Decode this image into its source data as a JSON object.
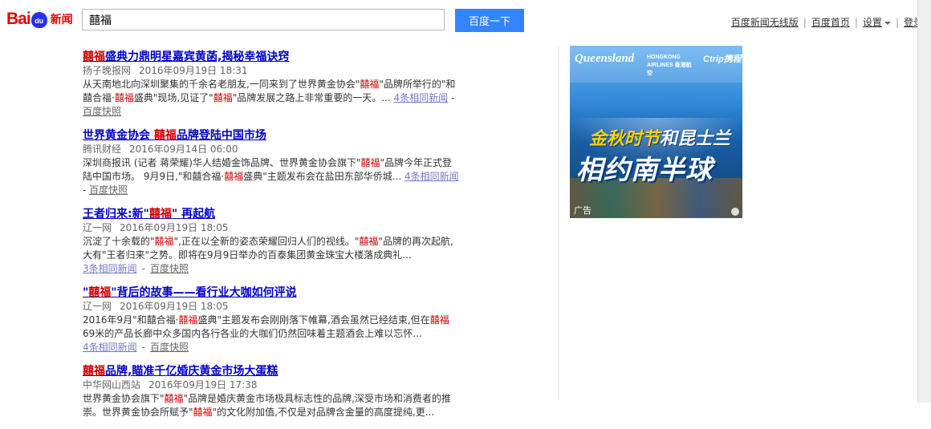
{
  "header": {
    "logo_bai": "Bai",
    "logo_du": "du",
    "logo_news": "新闻",
    "search_value": "囍福",
    "search_button": "百度一下",
    "links": {
      "mobile": "百度新闻无线版",
      "home": "百度首页",
      "settings": "设置",
      "login": "登录"
    }
  },
  "results": [
    {
      "title_hl": "囍福",
      "title_rest": "盛典力鼎明星嘉宾黄菡,揭秘幸福诀窍",
      "source": "扬子晚报网",
      "time": "2016年09月19日 18:31",
      "desc_parts": [
        {
          "t": "从天南地北向深圳聚集的千余名老朋友,一同来到了世界黄金协会\""
        },
        {
          "t": "囍福",
          "hl": true
        },
        {
          "t": "\"品牌所举行的\"和囍合福·"
        },
        {
          "t": "囍福",
          "hl": true
        },
        {
          "t": "盛典\"现场,见证了\""
        },
        {
          "t": "囍福",
          "hl": true
        },
        {
          "t": "\"品牌发展之路上非常重要的一天。..."
        }
      ],
      "same_news": "4条相同新闻",
      "snapshot": "百度快照"
    },
    {
      "title_pre": "世界黄金协会 ",
      "title_hl": "囍福",
      "title_rest": "品牌登陆中国市场",
      "source": "腾讯财经",
      "time": "2016年09月14日 06:00",
      "desc_parts": [
        {
          "t": "深圳商报讯 (记者 蒋荣耀)华人结婚金饰品牌、世界黄金协会旗下\""
        },
        {
          "t": "囍福",
          "hl": true
        },
        {
          "t": "\"品牌今年正式登陆中国市场。 9月9日,\"和囍合福·"
        },
        {
          "t": "囍福",
          "hl": true
        },
        {
          "t": "盛典\"主题发布会在盐田东部华侨城..."
        }
      ],
      "same_news": "4条相同新闻",
      "snapshot": "百度快照"
    },
    {
      "title_pre": "王者归来:新\"",
      "title_hl": "囍福",
      "title_rest": "\" 再起航",
      "source": "辽一网",
      "time": "2016年09月19日 18:05",
      "desc_parts": [
        {
          "t": "沉淀了十余载的\""
        },
        {
          "t": "囍福",
          "hl": true
        },
        {
          "t": "\",正在以全新的姿态荣耀回归人们的视线。\""
        },
        {
          "t": "囍福",
          "hl": true
        },
        {
          "t": "\"品牌的再次起航,大有\"王者归来\"之势。即将在9月9日举办的百泰集团黄金珠宝大楼落成典礼..."
        }
      ],
      "same_news": "3条相同新闻",
      "snapshot": "百度快照"
    },
    {
      "title_pre": "\"",
      "title_hl": "囍福",
      "title_rest": "\"背后的故事——看行业大咖如何评说",
      "source": "辽一网",
      "time": "2016年09月19日 18:05",
      "desc_parts": [
        {
          "t": "2016年9月\"和囍合福·"
        },
        {
          "t": "囍福",
          "hl": true
        },
        {
          "t": "盛典\"主题发布会刚刚落下帷幕,酒会虽然已经结束,但在"
        },
        {
          "t": "囍福",
          "hl": true
        },
        {
          "t": "69米的产品长廊中众多国内各行各业的大咖们仍然回味着主题酒会上难以忘怀..."
        }
      ],
      "same_news": "4条相同新闻",
      "snapshot": "百度快照"
    },
    {
      "title_hl": "囍福",
      "title_rest": "品牌,瞄准千亿婚庆黄金市场大蛋糕",
      "source": "中华网山西站",
      "time": "2016年09月19日 17:38",
      "desc_parts": [
        {
          "t": "世界黄金协会旗下\""
        },
        {
          "t": "囍福",
          "hl": true
        },
        {
          "t": "\"品牌是婚庆黄金市场极具标志性的品牌,深受市场和消费者的推崇。世界黄金协会所赋予\""
        },
        {
          "t": "囍福",
          "hl": true
        },
        {
          "t": "\"的文化附加值,不仅是对品牌含金量的高度提纯,更..."
        }
      ],
      "same_news": "",
      "snapshot": ""
    }
  ],
  "ad": {
    "brand1": "Queensland",
    "brand2": "HONGKONG AIRLINES 香港航空",
    "brand3": "Ctrip携程",
    "line1_yellow": "金秋时节",
    "line1_white": "和昆士兰",
    "line2": "相约南半球",
    "label": "广告"
  },
  "colors": {
    "link": "#0000cc",
    "highlight": "#cc0000",
    "button": "#3385ff",
    "logo_red": "#e10602",
    "logo_blue": "#2932e1"
  }
}
